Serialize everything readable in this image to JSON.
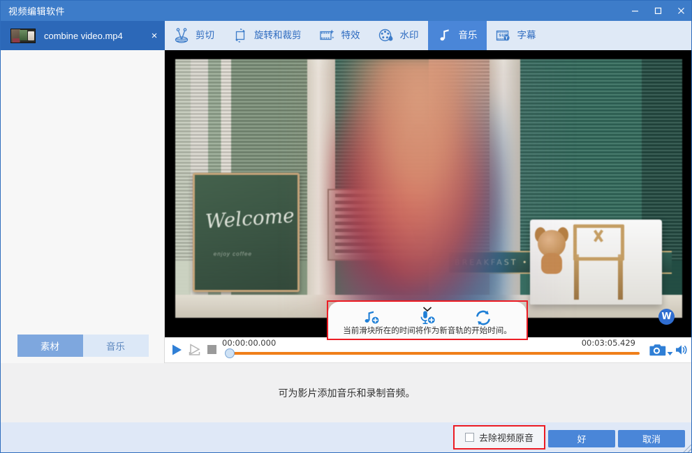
{
  "window": {
    "title": "视频编辑软件",
    "minimize_label": "minimize",
    "maximize_label": "maximize",
    "close_label": "close"
  },
  "file_tab": {
    "name": "combine video.mp4",
    "close_label": "×"
  },
  "toolbar": {
    "tabs": [
      {
        "label": "剪切",
        "icon": "scissors-icon",
        "active": false
      },
      {
        "label": "旋转和裁剪",
        "icon": "crop-icon",
        "active": false
      },
      {
        "label": "特效",
        "icon": "filmstrip-icon",
        "active": false
      },
      {
        "label": "水印",
        "icon": "watermark-icon",
        "active": false
      },
      {
        "label": "音乐",
        "icon": "music-note-icon",
        "active": true
      },
      {
        "label": "字幕",
        "icon": "subtitle-icon",
        "active": false
      }
    ]
  },
  "sidebar": {
    "tabs": [
      {
        "label": "素材",
        "active": true
      },
      {
        "label": "音乐",
        "active": false
      }
    ]
  },
  "preview": {
    "chalkboard_text": "Welcome",
    "chalkboard_subtext": "enjoy coffee",
    "sign_text": "BREAKFAST  •  LU",
    "watermark_letter": "W"
  },
  "music_popup": {
    "hint": "当前滑块所在的时间将作为新音轨的开始时间。",
    "actions": [
      {
        "name": "add-music",
        "icon": "music-note-plus-icon"
      },
      {
        "name": "record-audio",
        "icon": "microphone-plus-icon"
      },
      {
        "name": "replace-audio",
        "icon": "swap-refresh-icon"
      }
    ]
  },
  "transport": {
    "play_label": "play",
    "play_selection_label": "play-selection",
    "stop_label": "stop",
    "time_start": "00:00:00.000",
    "time_end": "00:03:05.429",
    "snapshot_label": "snapshot",
    "volume_label": "volume"
  },
  "description": {
    "text": "可为影片添加音乐和录制音频。"
  },
  "footer": {
    "checkbox_label": "去除视频原音",
    "checkbox_checked": false,
    "ok_label": "好",
    "cancel_label": "取消"
  },
  "colors": {
    "titlebar_blue": "#3d7cc9",
    "accent_blue": "#4a86d8",
    "tabstrip_bg": "#dfe9f6",
    "timeline_orange": "#f07f1a",
    "highlight_red": "#ec1c24",
    "footer_blue": "#dfe8f7"
  }
}
